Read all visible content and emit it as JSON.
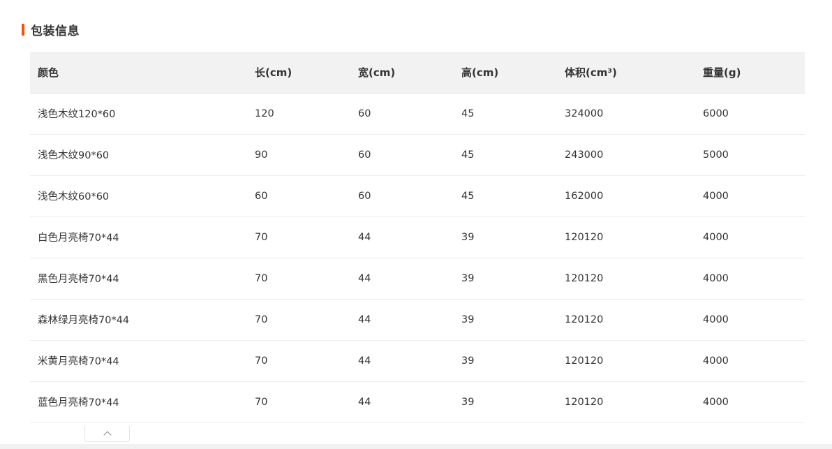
{
  "section": {
    "title": "包装信息",
    "accent_color": "#ff5000"
  },
  "table": {
    "headers": [
      "颜色",
      "长(cm)",
      "宽(cm)",
      "高(cm)",
      "体积(cm³)",
      "重量(g)"
    ],
    "rows": [
      [
        "浅色木纹120*60",
        "120",
        "60",
        "45",
        "324000",
        "6000"
      ],
      [
        "浅色木纹90*60",
        "90",
        "60",
        "45",
        "243000",
        "5000"
      ],
      [
        "浅色木纹60*60",
        "60",
        "60",
        "45",
        "162000",
        "4000"
      ],
      [
        "白色月亮椅70*44",
        "70",
        "44",
        "39",
        "120120",
        "4000"
      ],
      [
        "黑色月亮椅70*44",
        "70",
        "44",
        "39",
        "120120",
        "4000"
      ],
      [
        "森林绿月亮椅70*44",
        "70",
        "44",
        "39",
        "120120",
        "4000"
      ],
      [
        "米黄月亮椅70*44",
        "70",
        "44",
        "39",
        "120120",
        "4000"
      ],
      [
        "蓝色月亮椅70*44",
        "70",
        "44",
        "39",
        "120120",
        "4000"
      ]
    ]
  },
  "collapse_toggle": {
    "icon": "chevron-up-icon"
  }
}
